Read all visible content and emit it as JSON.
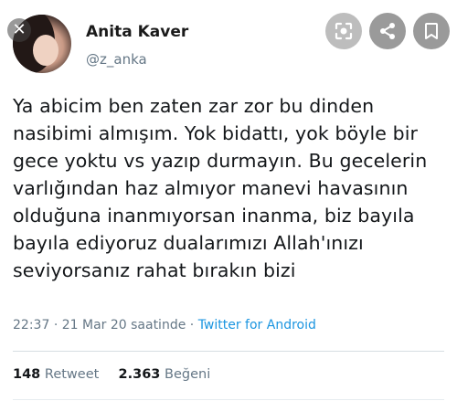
{
  "profile": {
    "name": "Anita Kaver",
    "handle": "@z_anka"
  },
  "overlay": {
    "close_glyph": "✕"
  },
  "tweet": {
    "lines": [
      "Ya abicim ben zaten zar zor bu dinden",
      "nasibimi almışım. Yok bidattı, yok böyle bir",
      "gece yoktu vs yazıp durmayın. Bu gecelerin",
      "varlığından haz almıyor manevi havasının",
      "olduğuna inanmıyorsan inanma, biz bayıla",
      "bayıla ediyoruz dualarımızı Allah'ınızı",
      "seviyorsanız rahat bırakın bizi"
    ],
    "time": "22:37",
    "date": "21 Mar 20 saatinde",
    "separator": "·",
    "source": "Twitter for Android"
  },
  "stats": {
    "retweets_count": "148",
    "retweets_label": "Retweet",
    "likes_count": "2.363",
    "likes_label": "Beğeni"
  },
  "icons": {
    "lens": "lens-icon",
    "share": "share-icon",
    "bookmark": "bookmark-icon",
    "close": "close-icon"
  },
  "colors": {
    "link": "#1b95e0",
    "secondary_text": "#657786",
    "primary_text": "#14171a"
  }
}
